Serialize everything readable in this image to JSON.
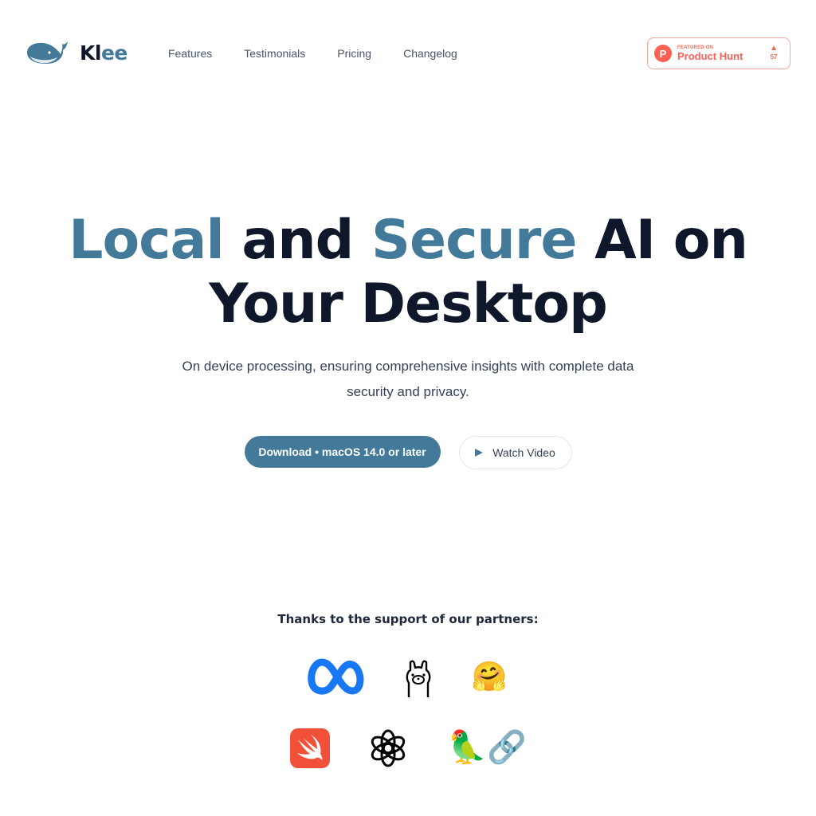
{
  "brand": {
    "name_first": "Kl",
    "name_rest": "ee",
    "logo_icon": "whale-icon",
    "accent": "#437a9a"
  },
  "nav": {
    "items": [
      {
        "label": "Features"
      },
      {
        "label": "Testimonials"
      },
      {
        "label": "Pricing"
      },
      {
        "label": "Changelog"
      }
    ]
  },
  "product_hunt": {
    "featured_label": "FEATURED ON",
    "name": "Product Hunt",
    "logo_letter": "P",
    "upvote_icon": "triangle-up-icon",
    "votes": "57",
    "color": "#ff6154"
  },
  "hero": {
    "title_w1": "Local",
    "title_w2": " and ",
    "title_w3": "Secure",
    "title_w4": " AI on",
    "title_line2": "Your Desktop",
    "subtitle": "On device processing, ensuring comprehensive insights with complete data security and privacy."
  },
  "cta": {
    "download_label": "Download • macOS 14.0 or later",
    "watch_label": "Watch Video",
    "watch_icon": "play-icon"
  },
  "partners": {
    "title": "Thanks to the support of our partners:",
    "items": [
      {
        "name": "Meta",
        "icon": "meta-icon"
      },
      {
        "name": "Ollama",
        "icon": "llama-icon"
      },
      {
        "name": "Hugging Face",
        "icon": "hugging-face-icon",
        "glyph": "🤗"
      },
      {
        "name": "Swift",
        "icon": "swift-icon"
      },
      {
        "name": "OpenAI",
        "icon": "openai-icon"
      },
      {
        "name": "LangChain",
        "icon": "parrot-link-icon",
        "glyph": "🦜🔗"
      }
    ]
  }
}
